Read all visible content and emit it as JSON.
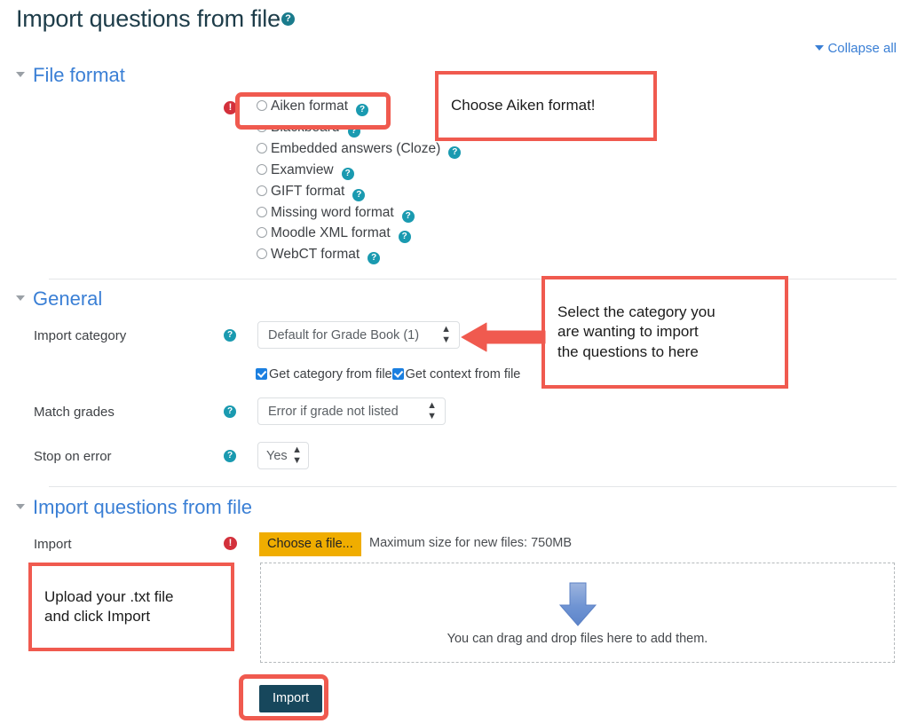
{
  "page": {
    "title": "Import questions from file",
    "title_help_icon": "help-circle-icon",
    "collapse_all": "Collapse all"
  },
  "sections": {
    "file_format": {
      "heading": "File format",
      "options": [
        {
          "label": "Aiken format",
          "selected": false
        },
        {
          "label": "Blackboard",
          "selected": false
        },
        {
          "label": "Embedded answers (Cloze)",
          "selected": false
        },
        {
          "label": "Examview",
          "selected": false
        },
        {
          "label": "GIFT format",
          "selected": false
        },
        {
          "label": "Missing word format",
          "selected": false
        },
        {
          "label": "Moodle XML format",
          "selected": false
        },
        {
          "label": "WebCT format",
          "selected": false
        }
      ]
    },
    "general": {
      "heading": "General",
      "import_category": {
        "label": "Import category",
        "value": "Default for Grade Book (1)",
        "checkbox_category": "Get category from file",
        "checkbox_context": "Get context from file",
        "checkbox_category_checked": true,
        "checkbox_context_checked": true
      },
      "match_grades": {
        "label": "Match grades",
        "value": "Error if grade not listed"
      },
      "stop_on_error": {
        "label": "Stop on error",
        "value": "Yes"
      }
    },
    "import_file": {
      "heading": "Import questions from file",
      "import_label": "Import",
      "choose_file_button": "Choose a file...",
      "max_size_text": "Maximum size for new files: 750MB",
      "dropzone_text": "You can drag and drop files here to add them.",
      "submit_button": "Import"
    }
  },
  "annotations": [
    {
      "id": "choose-aiken",
      "text": "Choose Aiken format!"
    },
    {
      "id": "select-category",
      "text": "Select the category you\nare wanting to import\nthe questions to here"
    },
    {
      "id": "upload-txt",
      "text": "Upload your .txt file\nand click Import"
    }
  ],
  "colors": {
    "heading_blue": "#3a7fd5",
    "title_dark": "#1d3c49",
    "help_teal": "#1a9ab0",
    "required_red": "#d3303b",
    "annotation_red": "#f05a4f",
    "choose_file_yellow": "#f0ad00",
    "import_button": "#17475c",
    "checkbox_blue": "#1b7fe0",
    "drop_arrow_blue": "#6f94d3"
  }
}
